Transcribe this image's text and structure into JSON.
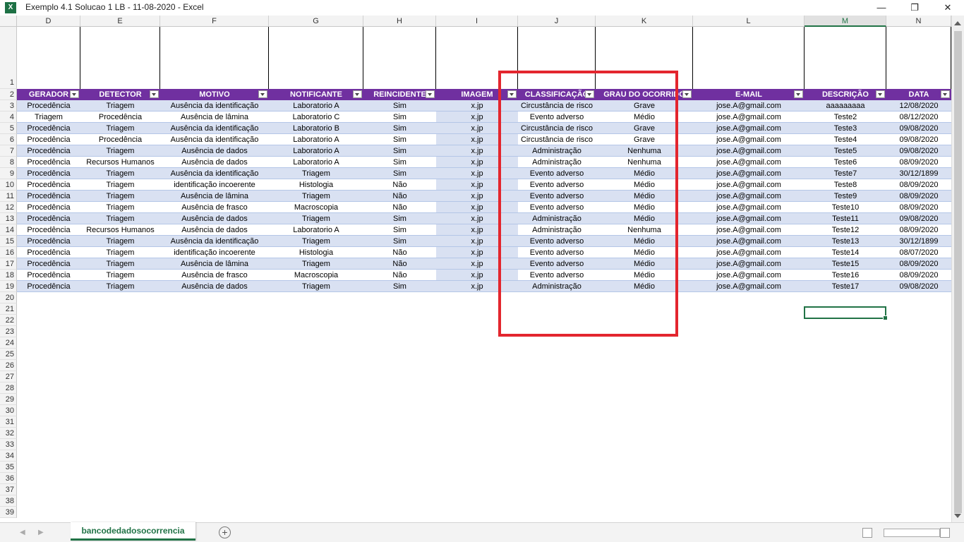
{
  "window": {
    "app_icon": "X",
    "title": "Exemplo 4.1 Solucao 1 LB - 11-08-2020 - Excel",
    "minimize": "—",
    "restore": "❐",
    "close": "✕"
  },
  "columns": [
    {
      "letter": "D",
      "header": "GERADOR"
    },
    {
      "letter": "E",
      "header": "DETECTOR"
    },
    {
      "letter": "F",
      "header": "MOTIVO"
    },
    {
      "letter": "G",
      "header": "NOTIFICANTE"
    },
    {
      "letter": "H",
      "header": "REINCIDENTE"
    },
    {
      "letter": "I",
      "header": "IMAGEM"
    },
    {
      "letter": "J",
      "header": "CLASSIFICAÇÃO"
    },
    {
      "letter": "K",
      "header": "GRAU DO OCORRIDO"
    },
    {
      "letter": "L",
      "header": "E-MAIL"
    },
    {
      "letter": "M",
      "header": "DESCRIÇÃO"
    },
    {
      "letter": "N",
      "header": "DATA"
    }
  ],
  "selected_column": "M",
  "rows": [
    [
      "Procedência",
      "Triagem",
      "Ausência da identificação",
      "Laboratorio A",
      "Sim",
      "x.jp",
      "Circustância de risco",
      "Grave",
      "jose.A@gmail.com",
      "aaaaaaaaa",
      "12/08/2020"
    ],
    [
      "Triagem",
      "Procedência",
      "Ausência de lâmina",
      "Laboratorio C",
      "Sim",
      "x.jp",
      "Evento adverso",
      "Médio",
      "jose.A@gmail.com",
      "Teste2",
      "08/12/2020"
    ],
    [
      "Procedência",
      "Triagem",
      "Ausência da identificação",
      "Laboratorio B",
      "Sim",
      "x.jp",
      "Circustância de risco",
      "Grave",
      "jose.A@gmail.com",
      "Teste3",
      "09/08/2020"
    ],
    [
      "Procedência",
      "Procedência",
      "Ausência da identificação",
      "Laboratorio A",
      "Sim",
      "x.jp",
      "Circustância de risco",
      "Grave",
      "jose.A@gmail.com",
      "Teste4",
      "09/08/2020"
    ],
    [
      "Procedência",
      "Triagem",
      "Ausência de dados",
      "Laboratorio A",
      "Sim",
      "x.jp",
      "Administração",
      "Nenhuma",
      "jose.A@gmail.com",
      "Teste5",
      "09/08/2020"
    ],
    [
      "Procedência",
      "Recursos Humanos",
      "Ausência de dados",
      "Laboratorio A",
      "Sim",
      "x.jp",
      "Administração",
      "Nenhuma",
      "jose.A@gmail.com",
      "Teste6",
      "08/09/2020"
    ],
    [
      "Procedência",
      "Triagem",
      "Ausência da identificação",
      "Triagem",
      "Sim",
      "x.jp",
      "Evento adverso",
      "Médio",
      "jose.A@gmail.com",
      "Teste7",
      "30/12/1899"
    ],
    [
      "Procedência",
      "Triagem",
      "identificação incoerente",
      "Histologia",
      "Não",
      "x.jp",
      "Evento adverso",
      "Médio",
      "jose.A@gmail.com",
      "Teste8",
      "08/09/2020"
    ],
    [
      "Procedência",
      "Triagem",
      "Ausência de lâmina",
      "Triagem",
      "Não",
      "x.jp",
      "Evento adverso",
      "Médio",
      "jose.A@gmail.com",
      "Teste9",
      "08/09/2020"
    ],
    [
      "Procedência",
      "Triagem",
      "Ausência de frasco",
      "Macroscopia",
      "Não",
      "x.jp",
      "Evento adverso",
      "Médio",
      "jose.A@gmail.com",
      "Teste10",
      "08/09/2020"
    ],
    [
      "Procedência",
      "Triagem",
      "Ausência de dados",
      "Triagem",
      "Sim",
      "x.jp",
      "Administração",
      "Médio",
      "jose.A@gmail.com",
      "Teste11",
      "09/08/2020"
    ],
    [
      "Procedência",
      "Recursos Humanos",
      "Ausência de dados",
      "Laboratorio A",
      "Sim",
      "x.jp",
      "Administração",
      "Nenhuma",
      "jose.A@gmail.com",
      "Teste12",
      "08/09/2020"
    ],
    [
      "Procedência",
      "Triagem",
      "Ausência da identificação",
      "Triagem",
      "Sim",
      "x.jp",
      "Evento adverso",
      "Médio",
      "jose.A@gmail.com",
      "Teste13",
      "30/12/1899"
    ],
    [
      "Procedência",
      "Triagem",
      "identificação incoerente",
      "Histologia",
      "Não",
      "x.jp",
      "Evento adverso",
      "Médio",
      "jose.A@gmail.com",
      "Teste14",
      "08/07/2020"
    ],
    [
      "Procedência",
      "Triagem",
      "Ausência de lâmina",
      "Triagem",
      "Não",
      "x.jp",
      "Evento adverso",
      "Médio",
      "jose.A@gmail.com",
      "Teste15",
      "08/09/2020"
    ],
    [
      "Procedência",
      "Triagem",
      "Ausência de frasco",
      "Macroscopia",
      "Não",
      "x.jp",
      "Evento adverso",
      "Médio",
      "jose.A@gmail.com",
      "Teste16",
      "08/09/2020"
    ],
    [
      "Procedência",
      "Triagem",
      "Ausência de dados",
      "Triagem",
      "Sim",
      "x.jp",
      "Administração",
      "Médio",
      "jose.A@gmail.com",
      "Teste17",
      "09/08/2020"
    ]
  ],
  "row_numbers": [
    "1",
    "2",
    "3",
    "4",
    "5",
    "6",
    "7",
    "8",
    "9",
    "10",
    "11",
    "12",
    "13",
    "14",
    "15",
    "16",
    "17",
    "18",
    "19",
    "20",
    "21",
    "22",
    "23",
    "24",
    "25",
    "26",
    "27",
    "28",
    "29",
    "30",
    "31",
    "32",
    "33",
    "34",
    "35",
    "36",
    "37",
    "38",
    "39"
  ],
  "sheet_tab": "bancodedadosocorrencia",
  "add_sheet": "+",
  "tab_nav": {
    "prev": "◀",
    "next": "▶"
  },
  "colors": {
    "header_fill": "#7030a0",
    "band_fill": "#d9e1f2",
    "highlight_box": "#e3262e",
    "excel_green": "#217346"
  }
}
